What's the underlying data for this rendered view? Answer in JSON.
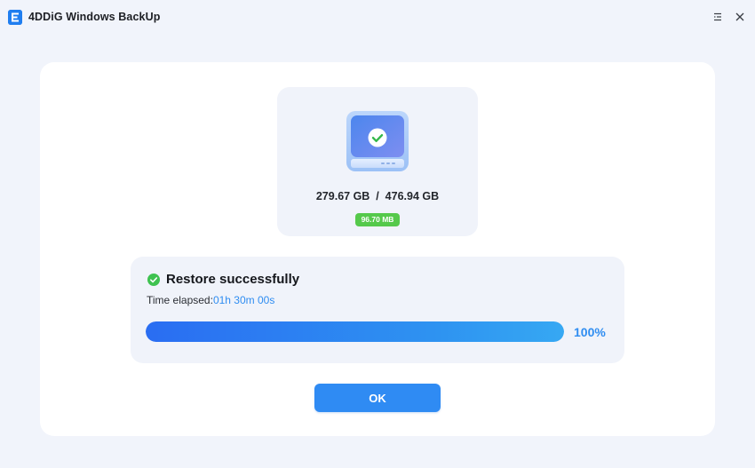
{
  "app": {
    "title": "4DDiG Windows BackUp",
    "logo_icon": "app-logo-icon"
  },
  "titlebar": {
    "menu_icon": "menu-icon",
    "close_icon": "close-icon"
  },
  "disk": {
    "icon": "disk-check-icon",
    "size_text": "279.67 GB  /  476.94 GB",
    "speed_badge": "96.70 MB"
  },
  "status": {
    "icon": "success-check-icon",
    "title": "Restore successfully",
    "time_label": "Time elapsed:",
    "time_value": "01h 30m 00s",
    "progress_fraction": 1.0,
    "progress_text": "100%"
  },
  "actions": {
    "ok_label": "OK"
  },
  "colors": {
    "accent": "#2f8bf3",
    "success": "#55c94b",
    "background": "#f1f4fb",
    "progress_start": "#2a6df2",
    "progress_end": "#36a8f3"
  }
}
